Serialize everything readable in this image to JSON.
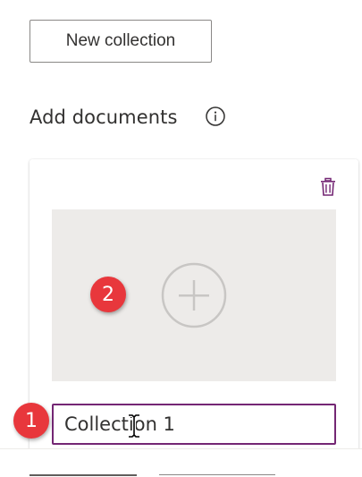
{
  "toolbar": {
    "new_collection_label": "New collection"
  },
  "section": {
    "title": "Add documents",
    "info_icon": "info-icon"
  },
  "card": {
    "delete_icon": "trash-icon",
    "upload_icon": "plus-circle-icon",
    "name_input_value": "Collection 1"
  },
  "annotations": {
    "badge_1": "1",
    "badge_2": "2"
  },
  "colors": {
    "accent": "#742774",
    "drop_zone": "#edebe9",
    "badge": "#e8373c",
    "text": "#323130"
  }
}
